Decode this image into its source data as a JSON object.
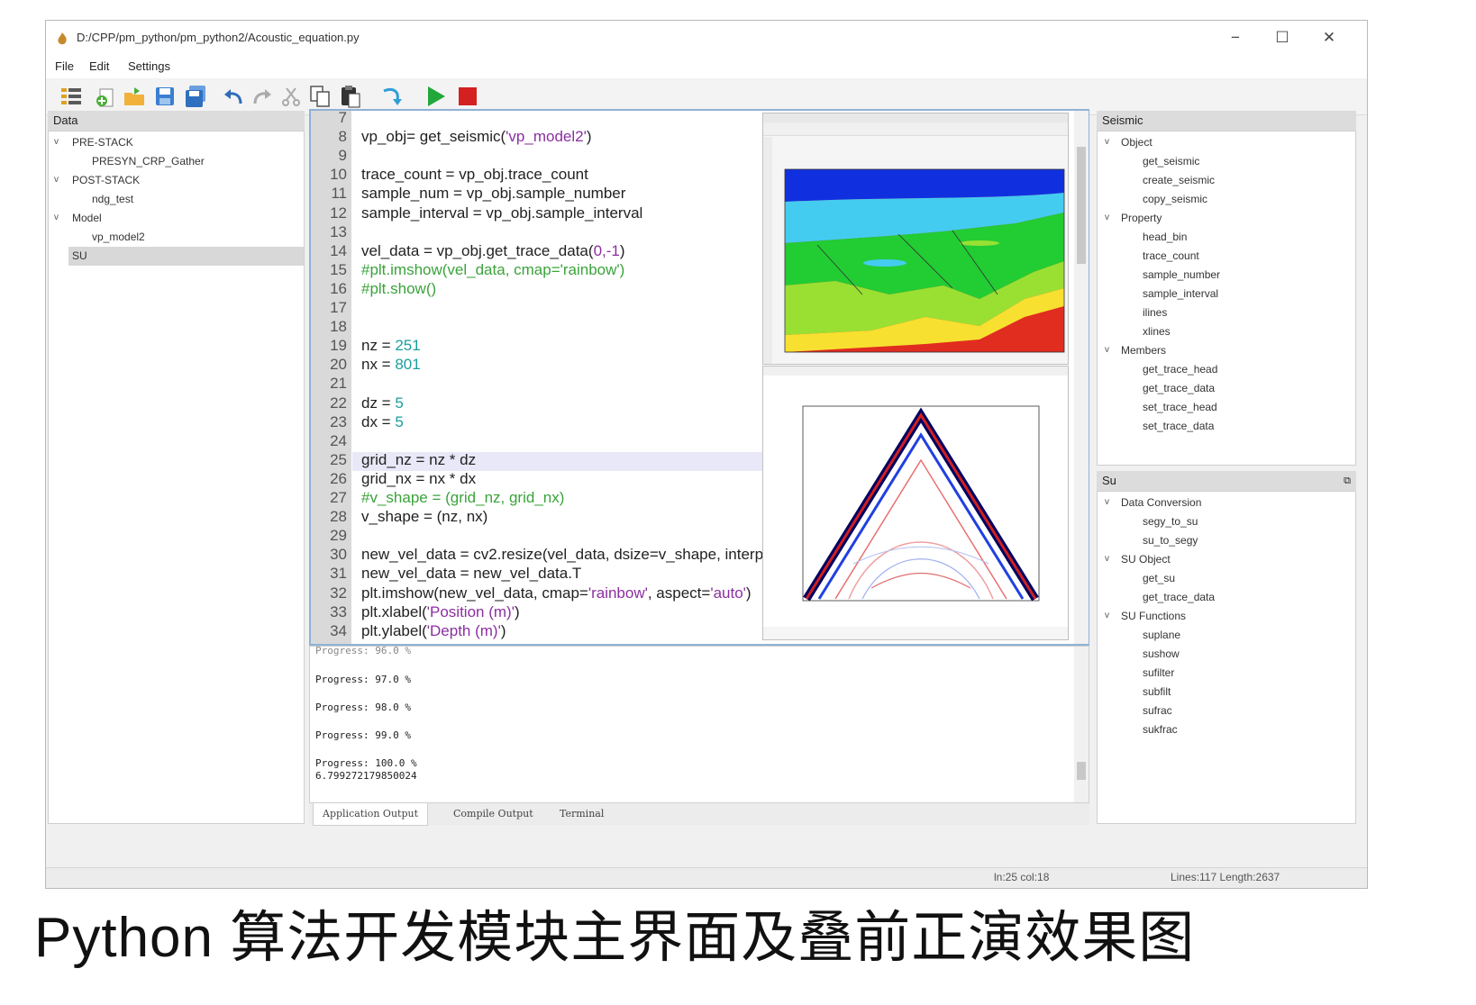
{
  "window": {
    "title": "D:/CPP/pm_python/pm_python2/Acoustic_equation.py",
    "minimize_glyph": "−",
    "maximize_glyph": "☐",
    "close_glyph": "✕"
  },
  "menu": [
    "File",
    "Edit",
    "Settings"
  ],
  "toolbar_icons": [
    "list-icon",
    "new-file-icon",
    "open-folder-icon",
    "save-icon",
    "save-all-icon",
    "undo-icon",
    "redo-icon",
    "cut-icon",
    "copy-icon",
    "paste-icon",
    "step-icon",
    "run-icon",
    "stop-icon"
  ],
  "colors": {
    "run": "#22a83a",
    "stop": "#d42020",
    "editor_border": "#8fb2d6"
  },
  "data_panel": {
    "header": "Data",
    "items": [
      {
        "label": "PRE-STACK",
        "level": 0,
        "expanded": true
      },
      {
        "label": "PRESYN_CRP_Gather",
        "level": 1
      },
      {
        "label": "POST-STACK",
        "level": 0,
        "expanded": true
      },
      {
        "label": "ndg_test",
        "level": 1
      },
      {
        "label": "Model",
        "level": 0,
        "expanded": true
      },
      {
        "label": "vp_model2",
        "level": 1
      },
      {
        "label": "SU",
        "level": 0,
        "selected": true
      }
    ]
  },
  "editor": {
    "lines": [
      {
        "n": "7",
        "html": ""
      },
      {
        "n": "8",
        "text": "vp_obj= get_seismic('vp_model2')"
      },
      {
        "n": "9",
        "text": ""
      },
      {
        "n": "10",
        "text": "trace_count = vp_obj.trace_count"
      },
      {
        "n": "11",
        "text": "sample_num = vp_obj.sample_number"
      },
      {
        "n": "12",
        "text": "sample_interval = vp_obj.sample_interval"
      },
      {
        "n": "13",
        "text": ""
      },
      {
        "n": "14",
        "text": "vel_data = vp_obj.get_trace_data(0,-1)"
      },
      {
        "n": "15",
        "text": "#plt.imshow(vel_data, cmap='rainbow')"
      },
      {
        "n": "16",
        "text": "#plt.show()"
      },
      {
        "n": "17",
        "text": ""
      },
      {
        "n": "18",
        "text": ""
      },
      {
        "n": "19",
        "text": "nz = 251"
      },
      {
        "n": "20",
        "text": "nx = 801"
      },
      {
        "n": "21",
        "text": ""
      },
      {
        "n": "22",
        "text": "dz = 5"
      },
      {
        "n": "23",
        "text": "dx = 5"
      },
      {
        "n": "24",
        "text": ""
      },
      {
        "n": "25",
        "text": "grid_nz = nz * dz"
      },
      {
        "n": "26",
        "text": "grid_nx = nx * dx"
      },
      {
        "n": "27",
        "text": "#v_shape = (grid_nz, grid_nx)"
      },
      {
        "n": "28",
        "text": "v_shape = (nz, nx)"
      },
      {
        "n": "29",
        "text": ""
      },
      {
        "n": "30",
        "text": "new_vel_data = cv2.resize(vel_data, dsize=v_shape, interp"
      },
      {
        "n": "31",
        "text": "new_vel_data = new_vel_data.T"
      },
      {
        "n": "32",
        "text": "plt.imshow(new_vel_data, cmap='rainbow', aspect='auto')"
      },
      {
        "n": "33",
        "text": "plt.xlabel('Position (m)')"
      },
      {
        "n": "34",
        "text": "plt.ylabel('Depth (m)')"
      }
    ]
  },
  "output": {
    "lines": [
      "Progress: 96.0 %",
      "Progress: 97.0 %",
      "Progress: 98.0 %",
      "Progress: 99.0 %",
      "Progress: 100.0 %",
      "6.799272179850024"
    ]
  },
  "tabs": [
    "Application Output",
    "Compile Output",
    "Terminal"
  ],
  "status": {
    "cursor": "ln:25 col:18",
    "stats": "Lines:117 Length:2637"
  },
  "seismic_panel": {
    "header": "Seismic",
    "items": [
      {
        "label": "Object",
        "level": 0
      },
      {
        "label": "get_seismic",
        "level": 1
      },
      {
        "label": "create_seismic",
        "level": 1
      },
      {
        "label": "copy_seismic",
        "level": 1
      },
      {
        "label": "Property",
        "level": 0
      },
      {
        "label": "head_bin",
        "level": 1
      },
      {
        "label": "trace_count",
        "level": 1
      },
      {
        "label": "sample_number",
        "level": 1
      },
      {
        "label": "sample_interval",
        "level": 1
      },
      {
        "label": "ilines",
        "level": 1
      },
      {
        "label": "xlines",
        "level": 1
      },
      {
        "label": "Members",
        "level": 0
      },
      {
        "label": "get_trace_head",
        "level": 1
      },
      {
        "label": "get_trace_data",
        "level": 1
      },
      {
        "label": "set_trace_head",
        "level": 1
      },
      {
        "label": "set_trace_data",
        "level": 1
      }
    ]
  },
  "su_panel": {
    "header": "Su",
    "items": [
      {
        "label": "Data Conversion",
        "level": 0
      },
      {
        "label": "segy_to_su",
        "level": 1
      },
      {
        "label": "su_to_segy",
        "level": 1
      },
      {
        "label": "SU Object",
        "level": 0
      },
      {
        "label": "get_su",
        "level": 1
      },
      {
        "label": "get_trace_data",
        "level": 1
      },
      {
        "label": "SU Functions",
        "level": 0
      },
      {
        "label": "suplane",
        "level": 1
      },
      {
        "label": "sushow",
        "level": 1
      },
      {
        "label": "sufilter",
        "level": 1
      },
      {
        "label": "subfilt",
        "level": 1
      },
      {
        "label": "sufrac",
        "level": 1
      },
      {
        "label": "sukfrac",
        "level": 1
      }
    ]
  },
  "caption": "Python 算法开发模块主界面及叠前正演效果图"
}
